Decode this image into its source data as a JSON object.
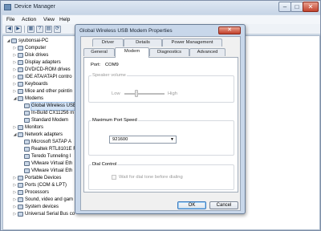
{
  "device_manager": {
    "title": "Device Manager",
    "menu": [
      "File",
      "Action",
      "View",
      "Help"
    ],
    "caption_buttons": {
      "minimize": "–",
      "maximize": "□",
      "close": "✕"
    },
    "toolbar": {
      "back": "◀",
      "forward": "▶",
      "view": "▦",
      "help": "?",
      "properties": "▤",
      "scan": "⟳"
    },
    "tree": [
      {
        "label": "syubonsai-PC",
        "expander": "◢"
      },
      {
        "label": "Computer",
        "expander": "▷"
      },
      {
        "label": "Disk drives",
        "expander": "▷"
      },
      {
        "label": "Display adapters",
        "expander": "▷"
      },
      {
        "label": "DVD/CD-ROM drives",
        "expander": "▷"
      },
      {
        "label": "IDE ATA/ATAPI contro",
        "expander": "▷"
      },
      {
        "label": "Keyboards",
        "expander": "▷"
      },
      {
        "label": "Mice and other pointin",
        "expander": "▷"
      },
      {
        "label": "Modems",
        "expander": "◢"
      },
      {
        "label": "Global Wireless USE",
        "expander": ""
      },
      {
        "label": "In-Build CX11256 m",
        "expander": ""
      },
      {
        "label": "Standard Modem",
        "expander": ""
      },
      {
        "label": "Monitors",
        "expander": "▷"
      },
      {
        "label": "Network adapters",
        "expander": "◢"
      },
      {
        "label": "Microsoft SATAP A",
        "expander": ""
      },
      {
        "label": "Realtek RTL8101E F",
        "expander": ""
      },
      {
        "label": "Teredo Tunneling I",
        "expander": ""
      },
      {
        "label": "VMware Virtual Eth",
        "expander": ""
      },
      {
        "label": "VMware Virtual Eth",
        "expander": ""
      },
      {
        "label": "Portable Devices",
        "expander": "▷"
      },
      {
        "label": "Ports (COM & LPT)",
        "expander": "▷"
      },
      {
        "label": "Processors",
        "expander": "▷"
      },
      {
        "label": "Sound, video and gam",
        "expander": "▷"
      },
      {
        "label": "System devices",
        "expander": "▷"
      },
      {
        "label": "Universal Serial Bus co",
        "expander": "▷"
      }
    ]
  },
  "dialog": {
    "title": "Global Wireless USB Modem Properties",
    "close": "✕",
    "tabs_back": [
      "Driver",
      "Details",
      "Power Management"
    ],
    "tabs_front": [
      "General",
      "Modem",
      "Diagnostics",
      "Advanced"
    ],
    "active_tab": "Modem",
    "port_label": "Port:",
    "port_value": "COM9",
    "speaker_group": "Speaker volume",
    "speaker_low": "Low",
    "speaker_high": "High",
    "speaker_level": 0.3,
    "max_speed_group": "Maximum Port Speed",
    "max_speed_value": "921600",
    "dial_group": "Dial Control",
    "wait_dial_tone": "Wait for dial tone before dialing",
    "wait_dial_tone_checked": false,
    "ok": "OK",
    "cancel": "Cancel"
  }
}
